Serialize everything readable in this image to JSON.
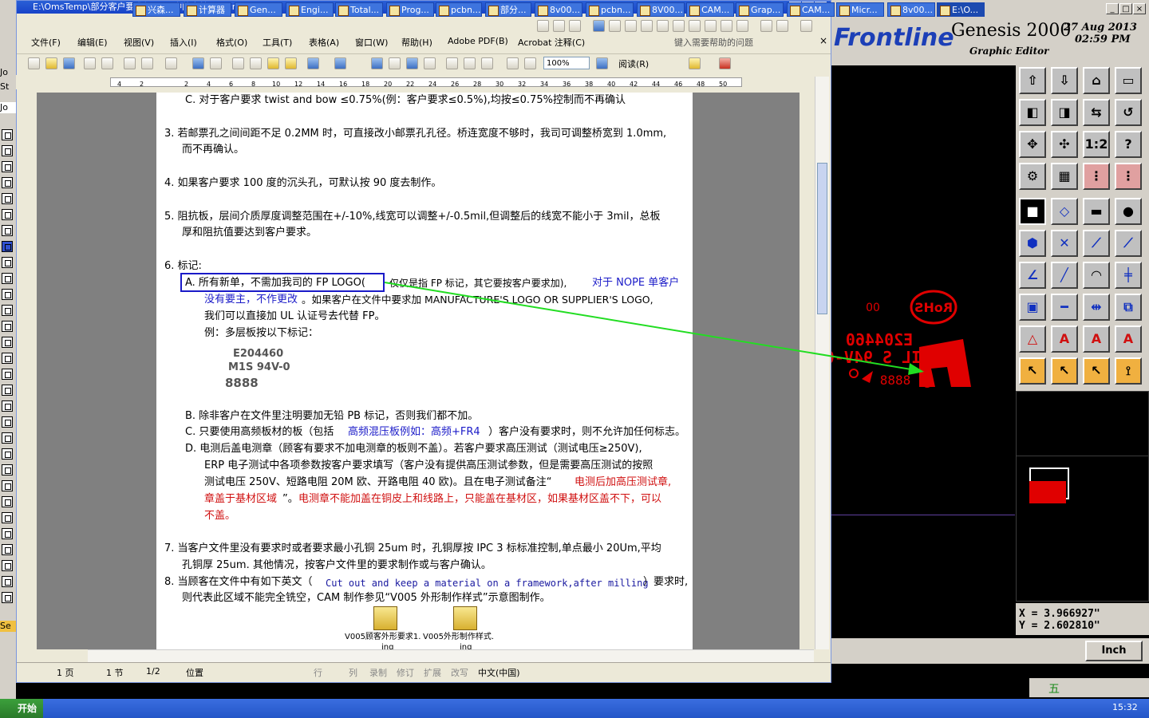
{
  "word": {
    "title": "E:\\OmsTemp\\部分客户要求新.doc 中的文档 - Microsoft Word",
    "menu": [
      "文件(F)",
      "编辑(E)",
      "视图(V)",
      "插入(I)",
      "格式(O)",
      "工具(T)",
      "表格(A)",
      "窗口(W)",
      "帮助(H)",
      "Adobe PDF(B)",
      "Acrobat 注释(C)"
    ],
    "help_placeholder": "键入需要帮助的问题",
    "zoom": "100%",
    "read_button": "阅读(R)",
    "ruler_ticks": [
      "4",
      "2",
      "2",
      "4",
      "6",
      "8",
      "10",
      "12",
      "14",
      "16",
      "18",
      "20",
      "22",
      "24",
      "26",
      "28",
      "30",
      "32",
      "34",
      "36",
      "38",
      "40",
      "42",
      "44",
      "46",
      "48",
      "50"
    ],
    "doc": {
      "line_c_prev": "C.  对于客户要求 twist and bow ≤0.75%(例：客户要求≤0.5%),均按≤0.75%控制而不再确认",
      "item3_a": "3.   若邮票孔之间间距不足 0.2MM 时，可直接改小邮票孔孔径。桥连宽度不够时，我司可调整桥宽到 1.0mm,",
      "item3_b": "而不再确认。",
      "item4": "4.   如果客户要求 100 度的沉头孔，可默认按 90 度去制作。",
      "item5_a": "5.   阻抗板，层间介质厚度调整范围在+/-10%,线宽可以调整+/-0.5mil,但调整后的线宽不能小于  3mil，总板",
      "item5_b": "厚和阻抗值要达到客户要求。",
      "item6": "6.   标记:",
      "a_boxed": "A.  所有新单，不需加我司的 FP LOGO(",
      "a_rest": "仅仅是指 FP  标记，其它要按客户要求加),",
      "a_blue": "对于 NOPE 单客户",
      "a_line2_blue": "没有要主，不作更改",
      "a_line2_rest": "。如果客户在文件中要求加 MANUFACTURE'S LOGO OR SUPPLIER'S LOGO,",
      "a_line3": "我们可以直接加 UL 认证号去代替 FP。",
      "a_line4": "例：多层板按以下标记：",
      "mark1": "E204460",
      "mark2": "M1S 94V-0",
      "mark3": "8888",
      "b_line": "B.  除非客户在文件里注明要加无铅 PB 标记，否则我们都不加。",
      "c_pre": "C.  只要使用高频板材的板（包括",
      "c_blue": "高频混压板例如：高频+FR4",
      "c_post": "）客户没有要求时，则不允许加任何标志。",
      "d_line1": "D.  电测后盖电测章（顾客有要求不加电测章的板则不盖）。若客户要求高压测试（测试电压≥250V),",
      "d_line2": "ERP 电子测试中各项参数按客户要求填写（客户没有提供高压测试参数，但是需要高压测试的按照",
      "d_line3_pre": "测试电压 250V、短路电阻 20M 欧、开路电阻 40 欧)。且在电子测试备注“",
      "d_line3_red": "电测后加高压测试章,",
      "d_line4_red1": "章盖于基材区域",
      "d_line4_mid": "”。",
      "d_line4_red2": "电测章不能加盖在铜皮上和线路上，只能盖在基材区，如果基材区盖不下，可以",
      "d_line5_red": "不盖。",
      "item7_a": "7.   当客户文件里没有要求时或者要求最小孔铜 25um 时，孔铜厚按 IPC 3 标标准控制,单点最小 20Um,平均",
      "item7_b": "孔铜厚 25um. 其他情况，按客户文件里的要求制作或与客户确认。",
      "item8_pre": "8.   当顾客在文件中有如下英文（",
      "item8_mono": "Cut out and keep a material on a framework,after milling",
      "item8_post": "）要求时,",
      "item8_b": "则代表此区域不能完全铣空，CAM 制作参见“V005 外形制作样式”示意图制作。",
      "icon1_label": "V005顾客外形要求1.",
      "icon1_sub": "ing",
      "icon2_label": "V005外形制作样式.",
      "icon2_sub": "ing"
    },
    "status": {
      "page": "1 页",
      "section": "1 节",
      "pages": "1/2",
      "position": "位置",
      "line": "行",
      "col": "列",
      "rec": "录制",
      "trk": "修订",
      "ext": "扩展",
      "ovr": "改写",
      "lang": "中文(中国)"
    }
  },
  "genesis": {
    "brand": "Frontline",
    "title": "Genesis 2000",
    "subtitle": "Graphic Editor",
    "date": "27 Aug 2013",
    "time": "02:59 PM",
    "tools_row_labels": [
      "1:2",
      "?"
    ],
    "coord_x": "X = 3.966927\"",
    "coord_y": "Y = 2.602810\"",
    "units": "Inch",
    "canvas_text": {
      "rohs": "RoHS",
      "code": "E204460",
      "grade": "MIL S 94V-0",
      "digits": "8888",
      "dots": "00"
    },
    "colors": {
      "board": "#e00000",
      "logo": "#1c3fb7"
    }
  },
  "left_strip": {
    "labels": [
      "Jo",
      "St",
      "Jo",
      "Se"
    ]
  },
  "taskbar": {
    "start": "开始",
    "tasks": [
      "兴森...",
      "计算器",
      "Gen...",
      "Engi...",
      "Total...",
      "Prog...",
      "pcbn...",
      "部分...",
      "8v00...",
      "pcbn...",
      "8V00...",
      "CAM...",
      "Grap...",
      "CAM...",
      "Micr...",
      "8v00...",
      "E:\\O..."
    ],
    "ime": "五",
    "clock": "15:32"
  },
  "annotation": {
    "arrow_color": "#22dd22",
    "box_color": "#1a1ac8"
  }
}
